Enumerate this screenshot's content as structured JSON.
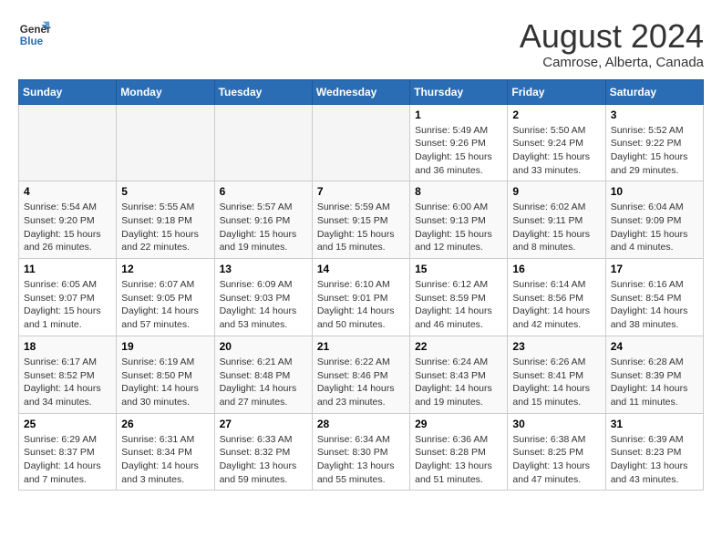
{
  "logo": {
    "line1": "General",
    "line2": "Blue"
  },
  "title": "August 2024",
  "subtitle": "Camrose, Alberta, Canada",
  "days_of_week": [
    "Sunday",
    "Monday",
    "Tuesday",
    "Wednesday",
    "Thursday",
    "Friday",
    "Saturday"
  ],
  "weeks": [
    [
      {
        "day": "",
        "info": "",
        "empty": true
      },
      {
        "day": "",
        "info": "",
        "empty": true
      },
      {
        "day": "",
        "info": "",
        "empty": true
      },
      {
        "day": "",
        "info": "",
        "empty": true
      },
      {
        "day": "1",
        "info": "Sunrise: 5:49 AM\nSunset: 9:26 PM\nDaylight: 15 hours\nand 36 minutes.",
        "empty": false
      },
      {
        "day": "2",
        "info": "Sunrise: 5:50 AM\nSunset: 9:24 PM\nDaylight: 15 hours\nand 33 minutes.",
        "empty": false
      },
      {
        "day": "3",
        "info": "Sunrise: 5:52 AM\nSunset: 9:22 PM\nDaylight: 15 hours\nand 29 minutes.",
        "empty": false
      }
    ],
    [
      {
        "day": "4",
        "info": "Sunrise: 5:54 AM\nSunset: 9:20 PM\nDaylight: 15 hours\nand 26 minutes.",
        "empty": false
      },
      {
        "day": "5",
        "info": "Sunrise: 5:55 AM\nSunset: 9:18 PM\nDaylight: 15 hours\nand 22 minutes.",
        "empty": false
      },
      {
        "day": "6",
        "info": "Sunrise: 5:57 AM\nSunset: 9:16 PM\nDaylight: 15 hours\nand 19 minutes.",
        "empty": false
      },
      {
        "day": "7",
        "info": "Sunrise: 5:59 AM\nSunset: 9:15 PM\nDaylight: 15 hours\nand 15 minutes.",
        "empty": false
      },
      {
        "day": "8",
        "info": "Sunrise: 6:00 AM\nSunset: 9:13 PM\nDaylight: 15 hours\nand 12 minutes.",
        "empty": false
      },
      {
        "day": "9",
        "info": "Sunrise: 6:02 AM\nSunset: 9:11 PM\nDaylight: 15 hours\nand 8 minutes.",
        "empty": false
      },
      {
        "day": "10",
        "info": "Sunrise: 6:04 AM\nSunset: 9:09 PM\nDaylight: 15 hours\nand 4 minutes.",
        "empty": false
      }
    ],
    [
      {
        "day": "11",
        "info": "Sunrise: 6:05 AM\nSunset: 9:07 PM\nDaylight: 15 hours\nand 1 minute.",
        "empty": false
      },
      {
        "day": "12",
        "info": "Sunrise: 6:07 AM\nSunset: 9:05 PM\nDaylight: 14 hours\nand 57 minutes.",
        "empty": false
      },
      {
        "day": "13",
        "info": "Sunrise: 6:09 AM\nSunset: 9:03 PM\nDaylight: 14 hours\nand 53 minutes.",
        "empty": false
      },
      {
        "day": "14",
        "info": "Sunrise: 6:10 AM\nSunset: 9:01 PM\nDaylight: 14 hours\nand 50 minutes.",
        "empty": false
      },
      {
        "day": "15",
        "info": "Sunrise: 6:12 AM\nSunset: 8:59 PM\nDaylight: 14 hours\nand 46 minutes.",
        "empty": false
      },
      {
        "day": "16",
        "info": "Sunrise: 6:14 AM\nSunset: 8:56 PM\nDaylight: 14 hours\nand 42 minutes.",
        "empty": false
      },
      {
        "day": "17",
        "info": "Sunrise: 6:16 AM\nSunset: 8:54 PM\nDaylight: 14 hours\nand 38 minutes.",
        "empty": false
      }
    ],
    [
      {
        "day": "18",
        "info": "Sunrise: 6:17 AM\nSunset: 8:52 PM\nDaylight: 14 hours\nand 34 minutes.",
        "empty": false
      },
      {
        "day": "19",
        "info": "Sunrise: 6:19 AM\nSunset: 8:50 PM\nDaylight: 14 hours\nand 30 minutes.",
        "empty": false
      },
      {
        "day": "20",
        "info": "Sunrise: 6:21 AM\nSunset: 8:48 PM\nDaylight: 14 hours\nand 27 minutes.",
        "empty": false
      },
      {
        "day": "21",
        "info": "Sunrise: 6:22 AM\nSunset: 8:46 PM\nDaylight: 14 hours\nand 23 minutes.",
        "empty": false
      },
      {
        "day": "22",
        "info": "Sunrise: 6:24 AM\nSunset: 8:43 PM\nDaylight: 14 hours\nand 19 minutes.",
        "empty": false
      },
      {
        "day": "23",
        "info": "Sunrise: 6:26 AM\nSunset: 8:41 PM\nDaylight: 14 hours\nand 15 minutes.",
        "empty": false
      },
      {
        "day": "24",
        "info": "Sunrise: 6:28 AM\nSunset: 8:39 PM\nDaylight: 14 hours\nand 11 minutes.",
        "empty": false
      }
    ],
    [
      {
        "day": "25",
        "info": "Sunrise: 6:29 AM\nSunset: 8:37 PM\nDaylight: 14 hours\nand 7 minutes.",
        "empty": false
      },
      {
        "day": "26",
        "info": "Sunrise: 6:31 AM\nSunset: 8:34 PM\nDaylight: 14 hours\nand 3 minutes.",
        "empty": false
      },
      {
        "day": "27",
        "info": "Sunrise: 6:33 AM\nSunset: 8:32 PM\nDaylight: 13 hours\nand 59 minutes.",
        "empty": false
      },
      {
        "day": "28",
        "info": "Sunrise: 6:34 AM\nSunset: 8:30 PM\nDaylight: 13 hours\nand 55 minutes.",
        "empty": false
      },
      {
        "day": "29",
        "info": "Sunrise: 6:36 AM\nSunset: 8:28 PM\nDaylight: 13 hours\nand 51 minutes.",
        "empty": false
      },
      {
        "day": "30",
        "info": "Sunrise: 6:38 AM\nSunset: 8:25 PM\nDaylight: 13 hours\nand 47 minutes.",
        "empty": false
      },
      {
        "day": "31",
        "info": "Sunrise: 6:39 AM\nSunset: 8:23 PM\nDaylight: 13 hours\nand 43 minutes.",
        "empty": false
      }
    ]
  ]
}
